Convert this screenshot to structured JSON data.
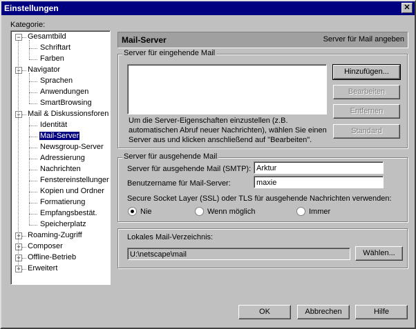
{
  "window": {
    "title": "Einstellungen",
    "close": "✕"
  },
  "kategorie_label": "Kategorie:",
  "tree": [
    {
      "label": "Gesamtbild",
      "level": 0,
      "expander": "−"
    },
    {
      "label": "Schriftart",
      "level": 1
    },
    {
      "label": "Farben",
      "level": 1
    },
    {
      "label": "Navigator",
      "level": 0,
      "expander": "−"
    },
    {
      "label": "Sprachen",
      "level": 1
    },
    {
      "label": "Anwendungen",
      "level": 1
    },
    {
      "label": "SmartBrowsing",
      "level": 1
    },
    {
      "label": "Mail & Diskussionsforen",
      "level": 0,
      "expander": "−"
    },
    {
      "label": "Identität",
      "level": 1
    },
    {
      "label": "Mail-Server",
      "level": 1,
      "selected": true
    },
    {
      "label": "Newsgroup-Server",
      "level": 1
    },
    {
      "label": "Adressierung",
      "level": 1
    },
    {
      "label": "Nachrichten",
      "level": 1
    },
    {
      "label": "Fenstereinstellungen",
      "level": 1
    },
    {
      "label": "Kopien und Ordner",
      "level": 1
    },
    {
      "label": "Formatierung",
      "level": 1
    },
    {
      "label": "Empfangsbestät.",
      "level": 1
    },
    {
      "label": "Speicherplatz",
      "level": 1
    },
    {
      "label": "Roaming-Zugriff",
      "level": 0,
      "expander": "+"
    },
    {
      "label": "Composer",
      "level": 0,
      "expander": "+"
    },
    {
      "label": "Offline-Betrieb",
      "level": 0,
      "expander": "+"
    },
    {
      "label": "Erweitert",
      "level": 0,
      "expander": "+"
    }
  ],
  "panel": {
    "title": "Mail-Server",
    "subtitle": "Server für Mail angeben"
  },
  "incoming": {
    "legend": "Server für eingehende Mail",
    "help_lines": [
      "Um die Server-Eigenschaften einzustellen (z.B.",
      "automatischen Abruf neuer Nachrichten), wählen Sie einen",
      "Server aus und klicken anschließend auf \"Bearbeiten\"."
    ],
    "buttons": {
      "add": "Hinzufügen...",
      "edit": "Bearbeiten",
      "remove": "Entfernen",
      "default": "Standard"
    }
  },
  "outgoing": {
    "legend": "Server für ausgehende Mail",
    "smtp_label": "Server für ausgehende Mail (SMTP):",
    "smtp_value": "Arktur",
    "user_label": "Benutzername für Mail-Server:",
    "user_value": "maxie",
    "ssl_label": "Secure Socket Layer (SSL) oder TLS für ausgehende Nachrichten verwenden:",
    "radio": {
      "never": "Nie",
      "if_possible": "Wenn möglich",
      "always": "Immer"
    }
  },
  "local": {
    "label": "Lokales Mail-Verzeichnis:",
    "path": "U:\\netscape\\mail",
    "choose": "Wählen..."
  },
  "footer": {
    "ok": "OK",
    "cancel": "Abbrechen",
    "help": "Hilfe"
  }
}
